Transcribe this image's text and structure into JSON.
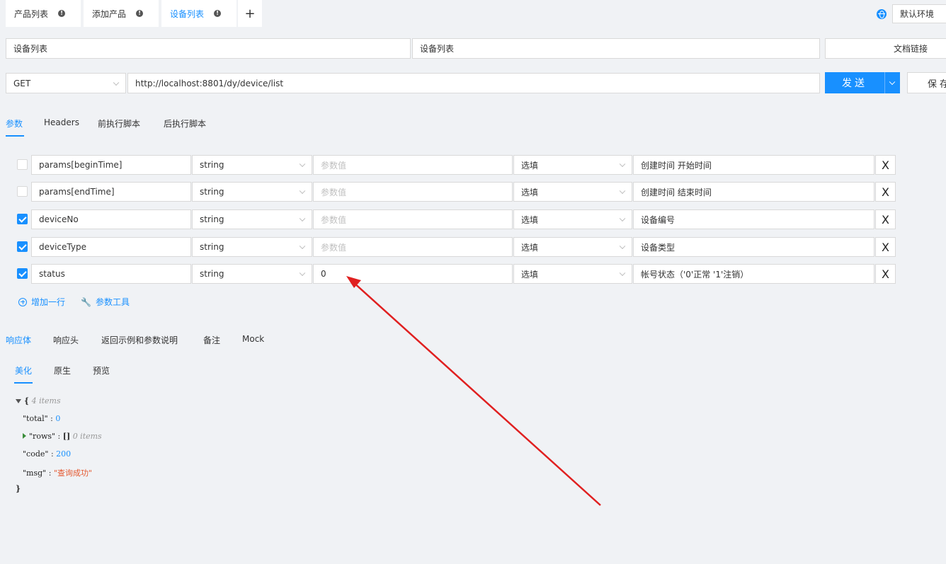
{
  "tabs": [
    {
      "label": "产品列表",
      "active": false
    },
    {
      "label": "添加产品",
      "active": false
    },
    {
      "label": "设备列表",
      "active": true
    }
  ],
  "tab_badge_symbol": "!",
  "tab_add_symbol": "+",
  "environment": {
    "label": "默认环境",
    "icon": "globe-icon"
  },
  "request": {
    "name": "设备列表",
    "folder": "设备列表",
    "doc_link_label": "文档链接",
    "method": "GET",
    "url": "http://localhost:8801/dy/device/list",
    "send_label": "发送",
    "save_label": "保存"
  },
  "request_tabs": [
    "参数",
    "Headers",
    "前执行脚本",
    "后执行脚本"
  ],
  "params": [
    {
      "checked": false,
      "name": "params[beginTime]",
      "type": "string",
      "value": "",
      "placeholder": "参数值",
      "required": "选填",
      "description": "创建时间 开始时间"
    },
    {
      "checked": false,
      "name": "params[endTime]",
      "type": "string",
      "value": "",
      "placeholder": "参数值",
      "required": "选填",
      "description": "创建时间 结束时间"
    },
    {
      "checked": true,
      "name": "deviceNo",
      "type": "string",
      "value": "",
      "placeholder": "参数值",
      "required": "选填",
      "description": "设备编号"
    },
    {
      "checked": true,
      "name": "deviceType",
      "type": "string",
      "value": "",
      "placeholder": "参数值",
      "required": "选填",
      "description": "设备类型"
    },
    {
      "checked": true,
      "name": "status",
      "type": "string",
      "value": "0",
      "placeholder": "参数值",
      "required": "选填",
      "description": "帐号状态（'0'正常 '1'注销）"
    }
  ],
  "delete_symbol": "X",
  "add_row_label": "增加一行",
  "param_tool_label": "参数工具",
  "response_tabs": [
    "响应体",
    "响应头",
    "返回示例和参数说明",
    "备注",
    "Mock"
  ],
  "response_view_tabs": [
    "美化",
    "原生",
    "预览"
  ],
  "json_view": {
    "open_brace": "{",
    "close_brace": "}",
    "item_count": "4 items",
    "total_key": "\"total\"",
    "total_value": "0",
    "rows_key": "\"rows\"",
    "rows_value": "[]",
    "rows_count": "0 items",
    "code_key": "\"code\"",
    "code_value": "200",
    "msg_key": "\"msg\"",
    "msg_value": "\"查询成功\"",
    "separator": " : "
  },
  "colors": {
    "accent": "#1890ff",
    "annotation_arrow": "#e02020",
    "string_value": "#e4572e"
  }
}
